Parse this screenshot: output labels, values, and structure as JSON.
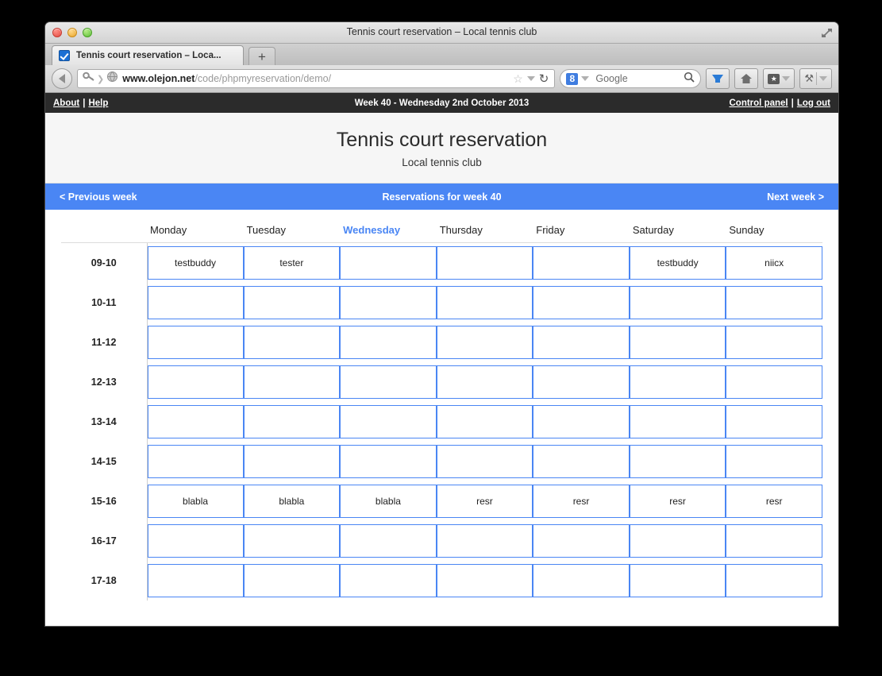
{
  "window": {
    "title": "Tennis court reservation – Local tennis club",
    "traffic_lights": [
      "close",
      "minimize",
      "maximize"
    ],
    "fullscreen_icon": "fullscreen-arrows-icon"
  },
  "browser": {
    "tab": {
      "title": "Tennis court reservation – Loca...",
      "favicon": "blue-checkbox-favicon"
    },
    "new_tab_label": "+",
    "back_icon": "back-arrow-icon",
    "url": {
      "domain": "www.olejon.net",
      "path": "/code/phpmyreservation/demo/",
      "key_icon": "key-icon",
      "chevron_icon": "chevron-right-icon",
      "globe_icon": "globe-icon",
      "star_icon": "star-icon",
      "dropdown_icon": "chevron-down-icon",
      "reload_icon": "reload-icon"
    },
    "search": {
      "engine_badge": "8",
      "engine_name": "Google",
      "dropdown_icon": "chevron-down-icon",
      "search_icon": "magnifier-icon"
    },
    "toolbar_buttons": [
      {
        "name": "download-button",
        "icon": "download-arrow-icon"
      },
      {
        "name": "home-button",
        "icon": "home-icon"
      },
      {
        "name": "bookmarks-button",
        "icon": "bookmark-star-icon"
      },
      {
        "name": "tools-button",
        "icon": "tools-icon"
      }
    ]
  },
  "site": {
    "topbar": {
      "about_label": "About",
      "separator": "|",
      "help_label": "Help",
      "date_label": "Week 40 - Wednesday 2nd October 2013",
      "control_panel_label": "Control panel",
      "logout_label": "Log out"
    },
    "header": {
      "title": "Tennis court reservation",
      "subtitle": "Local tennis club"
    },
    "weeknav": {
      "prev_label": "< Previous week",
      "title": "Reservations for week 40",
      "next_label": "Next week >",
      "accent_color": "#4a86f4"
    }
  },
  "schedule": {
    "time_column_header": "",
    "days": [
      {
        "label": "Monday",
        "active": false
      },
      {
        "label": "Tuesday",
        "active": false
      },
      {
        "label": "Wednesday",
        "active": true
      },
      {
        "label": "Thursday",
        "active": false
      },
      {
        "label": "Friday",
        "active": false
      },
      {
        "label": "Saturday",
        "active": false
      },
      {
        "label": "Sunday",
        "active": false
      }
    ],
    "rows": [
      {
        "time": "09-10",
        "slots": [
          "testbuddy",
          "tester",
          "",
          "",
          "",
          "testbuddy",
          "niicx"
        ]
      },
      {
        "time": "10-11",
        "slots": [
          "",
          "",
          "",
          "",
          "",
          "",
          ""
        ]
      },
      {
        "time": "11-12",
        "slots": [
          "",
          "",
          "",
          "",
          "",
          "",
          ""
        ]
      },
      {
        "time": "12-13",
        "slots": [
          "",
          "",
          "",
          "",
          "",
          "",
          ""
        ]
      },
      {
        "time": "13-14",
        "slots": [
          "",
          "",
          "",
          "",
          "",
          "",
          ""
        ]
      },
      {
        "time": "14-15",
        "slots": [
          "",
          "",
          "",
          "",
          "",
          "",
          ""
        ]
      },
      {
        "time": "15-16",
        "slots": [
          "blabla",
          "blabla",
          "blabla",
          "resr",
          "resr",
          "resr",
          "resr"
        ]
      },
      {
        "time": "16-17",
        "slots": [
          "",
          "",
          "",
          "",
          "",
          "",
          ""
        ]
      },
      {
        "time": "17-18",
        "slots": [
          "",
          "",
          "",
          "",
          "",
          "",
          ""
        ]
      }
    ]
  }
}
